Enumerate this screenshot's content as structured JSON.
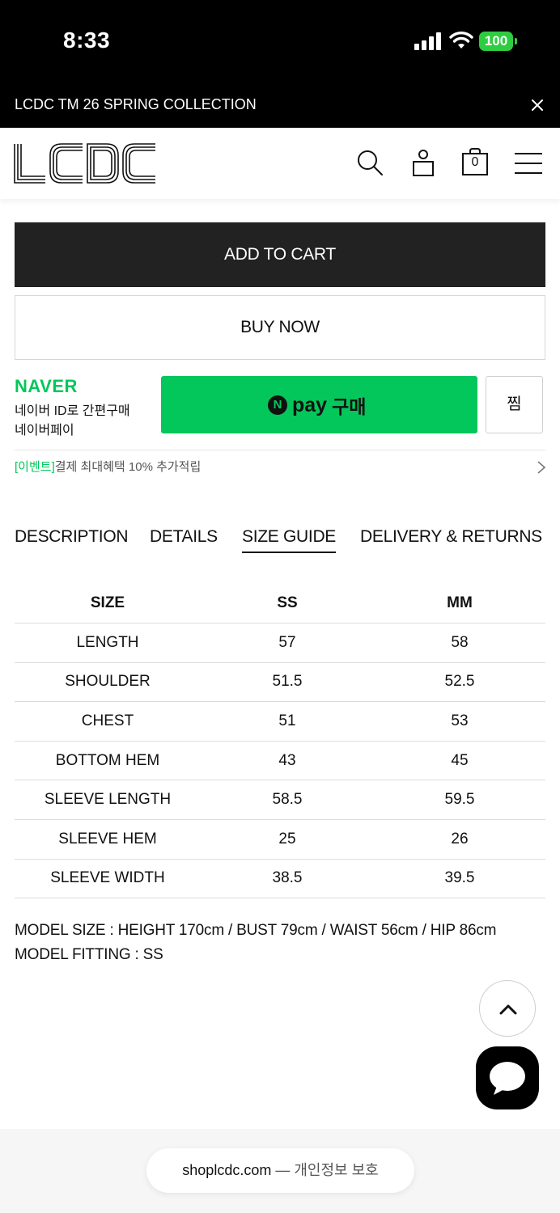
{
  "status_bar": {
    "time": "8:33",
    "battery": "100",
    "battery_color": "#2ecc40"
  },
  "announcement": {
    "text": "LCDC TM 26 SPRING COLLECTION",
    "close_icon": "close-icon"
  },
  "header": {
    "logo_text": "LCDC",
    "icons": [
      "search-icon",
      "user-icon",
      "shopping-bag-icon",
      "menu-icon"
    ],
    "cart_count": "0"
  },
  "actions": {
    "add_to_cart": "ADD TO CART",
    "buy_now": "BUY NOW"
  },
  "naver": {
    "brand": "NAVER",
    "line1": "네이버 ID로 간편구매",
    "line2": "네이버페이",
    "pay_n": "N",
    "pay_label": "pay",
    "pay_buy": "구매",
    "zzim": "찜",
    "event_tag": "[이벤트]",
    "event_text": "결제 최대혜택 10% 추가적립",
    "brand_color": "#03c75a"
  },
  "tabs": [
    {
      "label": "DESCRIPTION",
      "active": false
    },
    {
      "label": "DETAILS",
      "active": false
    },
    {
      "label": "SIZE GUIDE",
      "active": true
    },
    {
      "label": "DELIVERY & RETURNS",
      "active": false
    }
  ],
  "size_table": {
    "headers": [
      "SIZE",
      "SS",
      "MM"
    ],
    "rows": [
      [
        "LENGTH",
        "57",
        "58"
      ],
      [
        "SHOULDER",
        "51.5",
        "52.5"
      ],
      [
        "CHEST",
        "51",
        "53"
      ],
      [
        "BOTTOM HEM",
        "43",
        "45"
      ],
      [
        "SLEEVE LENGTH",
        "58.5",
        "59.5"
      ],
      [
        "SLEEVE HEM",
        "25",
        "26"
      ],
      [
        "SLEEVE WIDTH",
        "38.5",
        "39.5"
      ]
    ]
  },
  "model": {
    "size": "MODEL SIZE : HEIGHT 170cm / BUST 79cm / WAIST 56cm / HIP 86cm",
    "fitting": "MODEL FITTING : SS"
  },
  "floating": {
    "scroll_top_icon": "chevron-up-icon",
    "chat_icon": "chat-bubble-icon"
  },
  "browser": {
    "domain": "shoplcdc.com",
    "suffix": " — 개인정보 보호"
  }
}
